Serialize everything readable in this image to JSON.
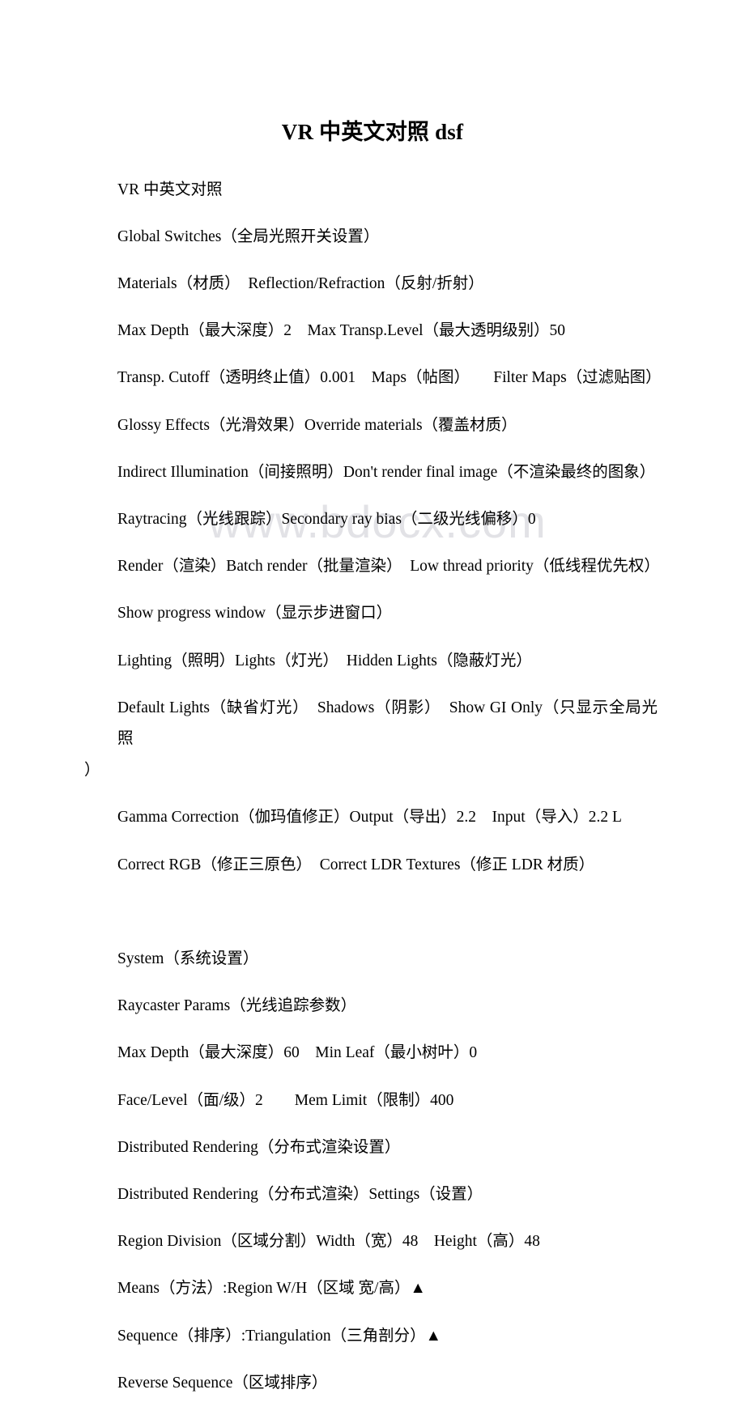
{
  "document": {
    "title": "VR 中英文对照 dsf",
    "watermark": "www.bdocx.com",
    "lines": [
      "VR 中英文对照",
      "Global Switches（全局光照开关设置）",
      "Materials（材质）　Reflection/Refraction（反射/折射）",
      "Max Depth（最大深度）2　Max Transp.Level（最大透明级别）50",
      "Transp. Cutoff（透明终止值）0.001　Maps（帖图）　　Filter Maps（过滤贴图）",
      "Glossy Effects（光滑效果）Override materials（覆盖材质）",
      "Indirect Illumination（间接照明）Don't render final image（不渲染最终的图象）",
      "Raytracing（光线跟踪）Secondary ray bias（二级光线偏移）0",
      "Render（渲染）Batch render（批量渲染）　Low thread priority（低线程优先权）",
      "Show progress window（显示步进窗口）",
      "Lighting（照明）Lights（灯光）　Hidden Lights（隐蔽灯光）",
      "Default Lights（缺省灯光）　Shadows（阴影）　Show GI Only（只显示全局光照",
      "）",
      "Gamma Correction（伽玛值修正）Output（导出）2.2　Input（导入）2.2 L",
      "Correct RGB（修正三原色）　Correct LDR Textures（修正 LDR 材质）",
      "",
      "System（系统设置）",
      "Raycaster Params（光线追踪参数）",
      "Max Depth（最大深度）60　Min Leaf（最小树叶）0",
      "Face/Level（面/级）2　　Mem Limit（限制）400",
      "Distributed Rendering（分布式渲染设置）",
      "Distributed Rendering（分布式渲染）Settings（设置）",
      "Region Division（区域分割）Width（宽）48　Height（高）48",
      "Means（方法）:Region W/H（区域 宽/高）▲",
      "Sequence（排序）:Triangulation（三角剖分）▲",
      "Reverse Sequence（区域排序）"
    ]
  }
}
